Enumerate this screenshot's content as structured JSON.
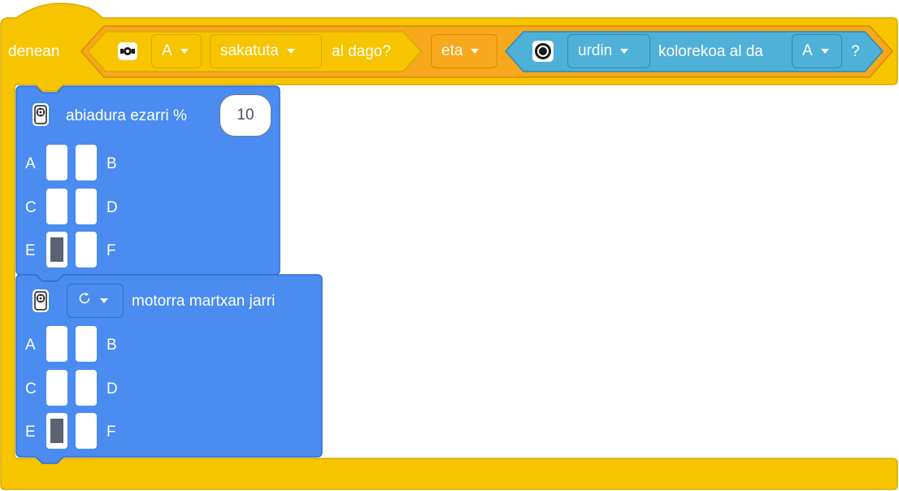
{
  "when_block": {
    "label": "denean",
    "button_sensor": {
      "icon": "button-sensor-icon",
      "port": "A",
      "state": "sakatuta",
      "suffix": "al dago?"
    },
    "operator": "eta",
    "color_sensor": {
      "icon": "color-sensor-icon",
      "color": "urdin",
      "text": "kolorekoa al da",
      "port": "A",
      "suffix": "?"
    }
  },
  "speed_block": {
    "icon": "motor-hub-icon",
    "label": "abiadura ezarri %",
    "value": "10",
    "ports": [
      "A",
      "B",
      "C",
      "D",
      "E",
      "F"
    ],
    "selected_port": "E"
  },
  "motor_block": {
    "icon": "motor-hub-icon",
    "direction_icon": "clockwise-icon",
    "label": "motorra martxan jarri",
    "ports": [
      "A",
      "B",
      "C",
      "D",
      "E",
      "F"
    ],
    "selected_port": "E"
  },
  "colors": {
    "event_yellow": "#f7c400",
    "operator_orange": "#f7a81c",
    "sensor_lightblue": "#4fb0d8",
    "motor_blue": "#4a8cf0"
  }
}
